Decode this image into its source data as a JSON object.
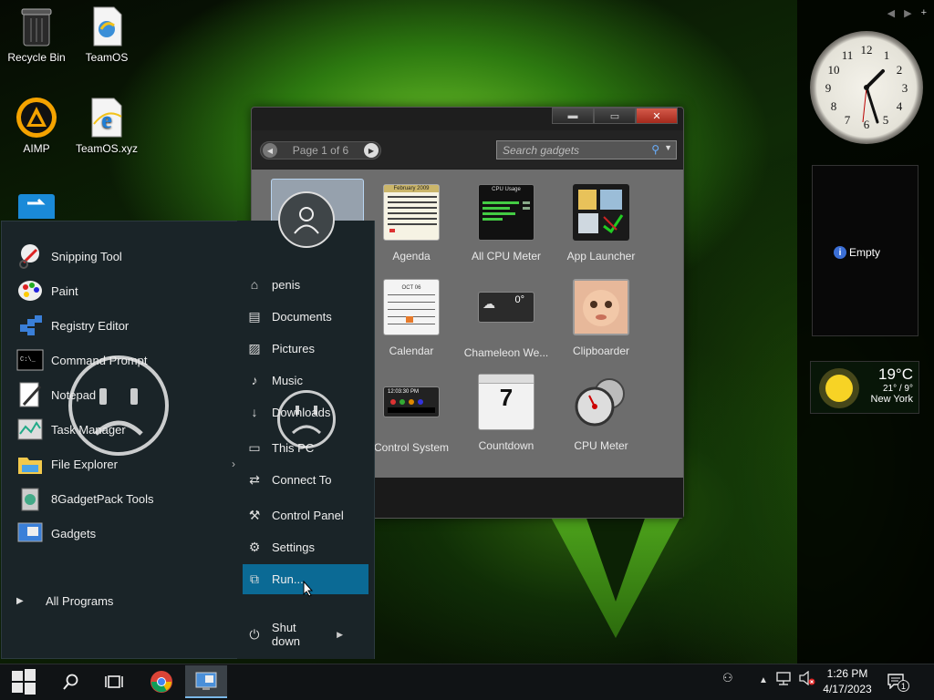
{
  "desktop": {
    "icons": [
      {
        "label": "Recycle Bin",
        "icon": "recycle-bin-icon"
      },
      {
        "label": "TeamOS",
        "icon": "document-icon"
      },
      {
        "label": "AIMP",
        "icon": "aimp-icon"
      },
      {
        "label": "TeamOS.xyz",
        "icon": "internet-explorer-icon"
      }
    ]
  },
  "gadget_window": {
    "pager_text": "Page 1 of 6",
    "search_placeholder": "Search gadgets",
    "gadgets": [
      {
        "label": "Agenda",
        "thumb_text": "February 2009"
      },
      {
        "label": "All CPU Meter",
        "thumb_text": "CPU Usage"
      },
      {
        "label": "App Launcher"
      },
      {
        "label": "Calendar",
        "thumb_text": "OCT 06"
      },
      {
        "label": "Chameleon We...",
        "thumb_text": "0°"
      },
      {
        "label": "Clipboarder"
      },
      {
        "label": "Control System",
        "thumb_text": "12:03:30 PM"
      },
      {
        "label": "Countdown",
        "thumb_text": "7"
      },
      {
        "label": "CPU Meter"
      }
    ]
  },
  "start_menu": {
    "programs": [
      {
        "label": "Snipping Tool",
        "icon": "snipping-tool-icon"
      },
      {
        "label": "Paint",
        "icon": "paint-icon"
      },
      {
        "label": "Registry Editor",
        "icon": "registry-editor-icon"
      },
      {
        "label": "Command Prompt",
        "icon": "command-prompt-icon"
      },
      {
        "label": "Notepad",
        "icon": "notepad-icon"
      },
      {
        "label": "Task Manager",
        "icon": "task-manager-icon"
      },
      {
        "label": "File Explorer",
        "icon": "file-explorer-icon"
      },
      {
        "label": "8GadgetPack Tools",
        "icon": "gadgetpack-tools-icon"
      },
      {
        "label": "Gadgets",
        "icon": "gadgets-icon"
      }
    ],
    "all_programs": "All Programs",
    "links": [
      {
        "label": "penis",
        "icon": "user-folder-icon"
      },
      {
        "label": "Documents",
        "icon": "documents-icon"
      },
      {
        "label": "Pictures",
        "icon": "pictures-icon"
      },
      {
        "label": "Music",
        "icon": "music-icon"
      },
      {
        "label": "Downloads",
        "icon": "downloads-icon"
      },
      {
        "label": "This PC",
        "icon": "computer-icon"
      },
      {
        "label": "Connect To",
        "icon": "connect-icon"
      },
      {
        "label": "Control Panel",
        "icon": "control-panel-icon"
      },
      {
        "label": "Settings",
        "icon": "settings-icon"
      },
      {
        "label": "Run...",
        "icon": "run-icon"
      }
    ],
    "shutdown": "Shut down"
  },
  "sidebar": {
    "clock_numbers": [
      "12",
      "1",
      "2",
      "3",
      "4",
      "5",
      "6",
      "7",
      "8",
      "9",
      "10",
      "11"
    ],
    "empty_label": "Empty",
    "weather": {
      "temp": "19°C",
      "range": "21° / 9°",
      "city": "New York"
    }
  },
  "taskbar": {
    "time": "1:26 PM",
    "date": "4/17/2023",
    "notification_count": "1"
  },
  "colors": {
    "start_bg": "#1a2428",
    "selected": "#0b6a95",
    "taskbar": "#101315"
  }
}
